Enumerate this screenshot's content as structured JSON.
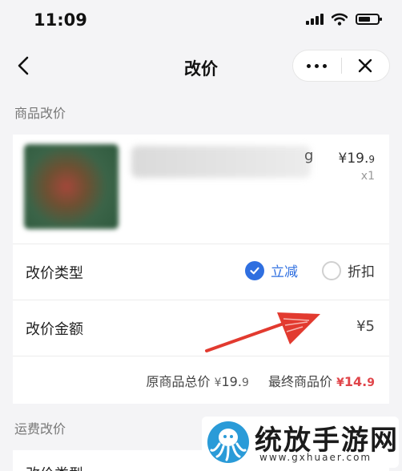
{
  "status_bar": {
    "time": "11:09"
  },
  "nav": {
    "title": "改价"
  },
  "product_section": {
    "title": "商品改价",
    "product": {
      "name_visible_tail": "g",
      "price": "¥19.",
      "price_decimal": "9",
      "quantity": "x1"
    },
    "price_change_type": {
      "label": "改价类型",
      "options": [
        {
          "label": "立减",
          "selected": true
        },
        {
          "label": "折扣",
          "selected": false
        }
      ]
    },
    "price_change_amount": {
      "label": "改价金额",
      "value": "¥5"
    },
    "summary": {
      "original_total_label": "原商品总价",
      "original_total_currency": "¥",
      "original_total_value": "19.",
      "original_total_decimal": "9",
      "final_price_label": "最终商品价",
      "final_price_currency": "¥",
      "final_price_value": "14.",
      "final_price_decimal": "9"
    }
  },
  "shipping_section": {
    "title": "运费改价",
    "next_row_label": "改价类型"
  },
  "watermark": {
    "title": "统放手游网",
    "url": "www.gxhuaer.com"
  },
  "colors": {
    "accent": "#2f6fe0",
    "final_price": "#e0454a",
    "annotation_arrow": "#e23a2f"
  }
}
